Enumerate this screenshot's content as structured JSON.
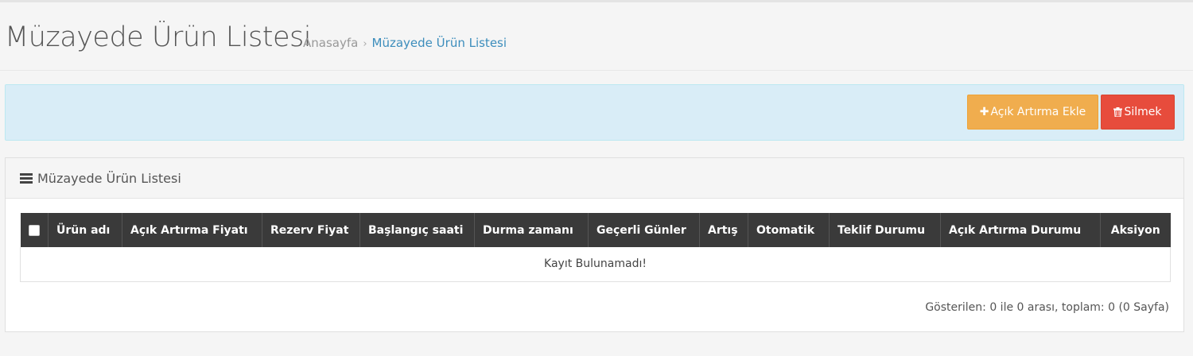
{
  "header": {
    "title": "Müzayede Ürün Listesi",
    "breadcrumb": {
      "home": "Anasayfa",
      "separator": "›",
      "current": "Müzayede Ürün Listesi"
    }
  },
  "toolbar": {
    "add_label": "Açık Artırma Ekle",
    "add_icon": "plus-icon",
    "delete_label": "Silmek",
    "delete_icon": "trash-icon"
  },
  "panel": {
    "title": "Müzayede Ürün Listesi",
    "icon": "list-icon"
  },
  "table": {
    "columns": [
      "Ürün adı",
      "Açık Artırma Fiyatı",
      "Rezerv Fiyat",
      "Başlangıç saati",
      "Durma zamanı",
      "Geçerli Günler",
      "Artış",
      "Otomatik",
      "Teklif Durumu",
      "Açık Artırma Durumu",
      "Aksiyon"
    ],
    "rows": [],
    "empty_message": "Kayıt Bulunamadı!"
  },
  "pagination": {
    "summary": "Gösterilen: 0 ile 0 arası, toplam: 0 (0 Sayfa)"
  },
  "colors": {
    "accent": "#3c8dbc",
    "add_button": "#f0ad4e",
    "delete_button": "#e74c3c",
    "table_header": "#3a3a3a",
    "info_bar": "#d9edf7"
  }
}
